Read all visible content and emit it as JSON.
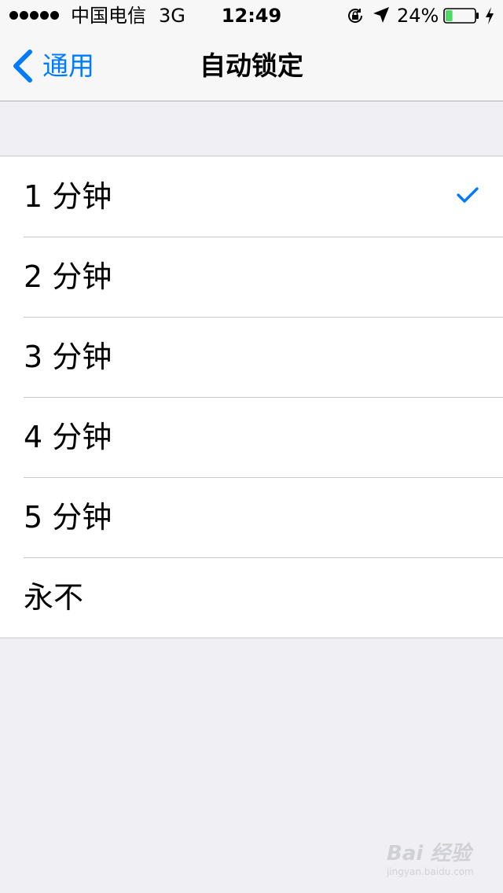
{
  "status_bar": {
    "carrier": "中国电信",
    "network": "3G",
    "time": "12:49",
    "battery_percent": "24%",
    "battery_level": 0.24,
    "signal_bars": 5
  },
  "nav": {
    "back_label": "通用",
    "title": "自动锁定"
  },
  "options": [
    {
      "label": "1 分钟",
      "selected": true
    },
    {
      "label": "2 分钟",
      "selected": false
    },
    {
      "label": "3 分钟",
      "selected": false
    },
    {
      "label": "4 分钟",
      "selected": false
    },
    {
      "label": "5 分钟",
      "selected": false
    },
    {
      "label": "永不",
      "selected": false
    }
  ],
  "colors": {
    "accent": "#007aff",
    "battery_fill": "#4cd964",
    "background": "#efeff4"
  },
  "icons": {
    "back": "chevron-left-icon",
    "selected": "checkmark-icon",
    "rotation_lock": "rotation-lock-icon",
    "location": "location-arrow-icon",
    "battery": "battery-icon",
    "charging": "lightning-bolt-icon"
  },
  "watermark": {
    "text": "Bai 经验",
    "sub": "jingyan.baidu.com"
  }
}
